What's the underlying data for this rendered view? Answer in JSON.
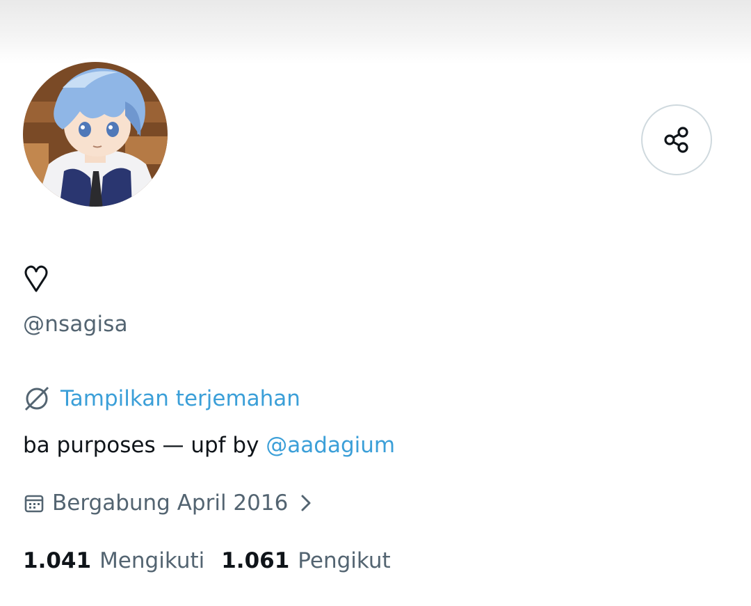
{
  "profile": {
    "display_name_icon": "heart-outline-icon",
    "handle": "@nsagisa",
    "translate_label": "Tampilkan terjemahan",
    "bio_text": "ba purposes — upf by ",
    "bio_mention": "@aadagium",
    "joined_label": "Bergabung April 2016",
    "following_count": "1.041",
    "following_label": "Mengikuti",
    "followers_count": "1.061",
    "followers_label": "Pengikut"
  },
  "icons": {
    "share": "share-icon",
    "translate": "translate-globe-icon",
    "calendar": "calendar-icon",
    "chevron": "chevron-right-icon"
  },
  "colors": {
    "link": "#3b9fd8",
    "secondary_text": "#536471",
    "primary_text": "#0f1419",
    "border": "#cfd9de"
  }
}
